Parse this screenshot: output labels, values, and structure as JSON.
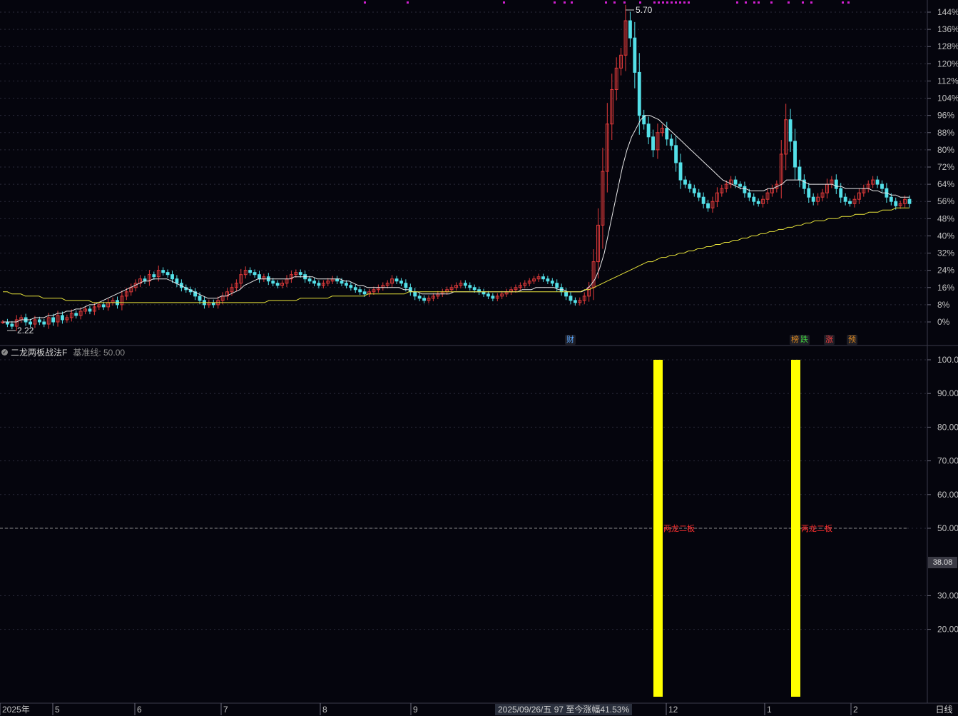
{
  "chart_data": [
    {
      "type": "candlestick",
      "title": "",
      "xlabel": "",
      "ylabel": "",
      "y_axis_ticks": [
        "144%",
        "136%",
        "128%",
        "120%",
        "112%",
        "104%",
        "96%",
        "88%",
        "80%",
        "72%",
        "64%",
        "56%",
        "48%",
        "40%",
        "32%",
        "24%",
        "16%",
        "8%",
        "0%"
      ],
      "ylim_percent": [
        -3,
        146
      ],
      "x_axis_ticks": [
        "2025年",
        "5",
        "6",
        "7",
        "8",
        "9",
        "12",
        "1",
        "2"
      ],
      "annotations": {
        "high_label": "5.70",
        "low_label": "2.22"
      },
      "series": [
        {
          "name": "",
          "kind": "candles",
          "close_percent": [
            0,
            -1,
            -2,
            1,
            2,
            0,
            -1,
            1,
            0,
            -1,
            2,
            0,
            3,
            1,
            2,
            4,
            3,
            5,
            6,
            5,
            7,
            8,
            7,
            9,
            10,
            8,
            12,
            14,
            16,
            18,
            20,
            19,
            22,
            21,
            24,
            23,
            22,
            20,
            18,
            16,
            15,
            14,
            12,
            10,
            8,
            9,
            8,
            10,
            12,
            14,
            16,
            18,
            22,
            24,
            23,
            22,
            20,
            21,
            19,
            18,
            17,
            18,
            20,
            22,
            23,
            22,
            20,
            19,
            18,
            17,
            18,
            19,
            20,
            19,
            18,
            17,
            16,
            15,
            14,
            13,
            14,
            15,
            16,
            17,
            18,
            20,
            19,
            18,
            16,
            14,
            12,
            11,
            10,
            11,
            12,
            13,
            14,
            15,
            16,
            17,
            18,
            17,
            16,
            15,
            14,
            13,
            12,
            11,
            12,
            13,
            14,
            15,
            16,
            17,
            18,
            19,
            20,
            21,
            20,
            19,
            18,
            16,
            14,
            12,
            10,
            9,
            10,
            12,
            16,
            28,
            45,
            70,
            92,
            108,
            118,
            124,
            140,
            132,
            116,
            96,
            92,
            86,
            80,
            88,
            90,
            85,
            82,
            74,
            66,
            64,
            62,
            60,
            58,
            55,
            53,
            56,
            60,
            62,
            64,
            66,
            64,
            63,
            60,
            58,
            56,
            55,
            57,
            60,
            62,
            64,
            78,
            94,
            84,
            72,
            66,
            62,
            58,
            56,
            58,
            60,
            64,
            66,
            62,
            58,
            56,
            55,
            57,
            60,
            62,
            64,
            66,
            64,
            62,
            58,
            56,
            54,
            55,
            57,
            55
          ]
        },
        {
          "name": "",
          "kind": "ma-white",
          "values_percent": [
            0,
            0,
            0,
            0,
            1,
            1,
            1,
            2,
            2,
            2,
            3,
            3,
            4,
            4,
            5,
            5,
            6,
            6,
            7,
            8,
            8,
            9,
            10,
            11,
            12,
            13,
            14,
            15,
            16,
            17,
            18,
            19,
            19,
            20,
            20,
            20,
            20,
            19,
            18,
            17,
            16,
            15,
            14,
            13,
            12,
            11,
            11,
            11,
            12,
            12,
            13,
            14,
            15,
            17,
            18,
            19,
            20,
            20,
            20,
            20,
            20,
            20,
            20,
            20,
            21,
            21,
            21,
            21,
            21,
            20,
            20,
            20,
            20,
            20,
            20,
            19,
            19,
            18,
            17,
            17,
            16,
            16,
            16,
            16,
            16,
            16,
            16,
            16,
            15,
            15,
            14,
            14,
            13,
            13,
            13,
            13,
            13,
            13,
            13,
            14,
            14,
            14,
            14,
            14,
            14,
            14,
            14,
            14,
            14,
            14,
            14,
            14,
            14,
            14,
            15,
            15,
            15,
            16,
            16,
            16,
            16,
            16,
            15,
            15,
            14,
            14,
            14,
            14,
            15,
            17,
            20,
            25,
            32,
            42,
            52,
            62,
            72,
            80,
            86,
            90,
            94,
            96,
            96,
            95,
            94,
            92,
            90,
            88,
            86,
            84,
            82,
            80,
            78,
            76,
            74,
            72,
            70,
            68,
            66,
            65,
            64,
            63,
            62,
            62,
            61,
            61,
            61,
            61,
            62,
            62,
            63,
            64,
            66,
            66,
            66,
            66,
            65,
            64,
            64,
            64,
            64,
            64,
            64,
            63,
            63,
            62,
            62,
            62,
            62,
            62,
            62,
            61,
            61,
            60,
            60,
            59,
            59,
            58,
            58,
            58
          ]
        },
        {
          "name": "",
          "kind": "ma-yellow",
          "values_percent": [
            14,
            14,
            13,
            13,
            13,
            12,
            12,
            12,
            12,
            11,
            11,
            11,
            11,
            11,
            10,
            10,
            10,
            10,
            10,
            10,
            9,
            9,
            9,
            9,
            9,
            9,
            9,
            9,
            9,
            9,
            9,
            9,
            9,
            9,
            9,
            9,
            9,
            9,
            9,
            9,
            9,
            9,
            9,
            9,
            9,
            9,
            9,
            9,
            9,
            9,
            9,
            9,
            9,
            9,
            9,
            9,
            9,
            9,
            9,
            10,
            10,
            10,
            10,
            10,
            10,
            10,
            11,
            11,
            11,
            11,
            11,
            11,
            11,
            12,
            12,
            12,
            12,
            12,
            12,
            12,
            12,
            13,
            13,
            13,
            13,
            13,
            13,
            13,
            13,
            13,
            14,
            14,
            14,
            14,
            14,
            14,
            14,
            14,
            14,
            14,
            14,
            14,
            14,
            14,
            14,
            14,
            14,
            14,
            14,
            14,
            14,
            14,
            14,
            14,
            14,
            14,
            14,
            14,
            14,
            14,
            14,
            14,
            14,
            14,
            14,
            14,
            14,
            14,
            14,
            15,
            15,
            16,
            17,
            18,
            19,
            20,
            21,
            22,
            23,
            24,
            25,
            26,
            27,
            28,
            28,
            29,
            30,
            30,
            31,
            31,
            32,
            32,
            33,
            33,
            34,
            34,
            35,
            35,
            36,
            36,
            37,
            37,
            38,
            38,
            39,
            39,
            40,
            40,
            41,
            41,
            42,
            42,
            43,
            43,
            44,
            44,
            45,
            45,
            46,
            46,
            47,
            47,
            47,
            48,
            48,
            48,
            49,
            49,
            49,
            50,
            50,
            50,
            51,
            51,
            51,
            52,
            52,
            52,
            53,
            53,
            53,
            53
          ]
        }
      ]
    },
    {
      "type": "bar",
      "title": "二龙两板战法F",
      "baseline_label": "基准线: 50.00",
      "y_axis_ticks": [
        "100.00",
        "90.00",
        "80.00",
        "70.00",
        "60.00",
        "50.00",
        "30.00",
        "20.00"
      ],
      "ylim": [
        0,
        100
      ],
      "current_value_label": "38.08",
      "series": [
        {
          "name": "",
          "bars": [
            {
              "value": 100,
              "label": "两龙二板"
            },
            {
              "value": 100,
              "label": "两龙二板"
            }
          ]
        }
      ]
    }
  ],
  "badges": [
    {
      "text": "财",
      "color": "#5aa8ff"
    },
    {
      "text": "榜",
      "color": "#e08a20"
    },
    {
      "text": "跌",
      "color": "#40d040"
    },
    {
      "text": "涨",
      "color": "#ff4040"
    },
    {
      "text": "预",
      "color": "#e08a20"
    }
  ],
  "status": "2025/09/26/五 97 至今涨幅41.53%",
  "period_button": "日线",
  "colors": {
    "up": "#e03a3a",
    "down": "#54e0e8",
    "ma_white": "#e8e8e8",
    "ma_yellow": "#e6e23a",
    "indicator_bar": "#ffff00",
    "axis_text": "#c0c0c0",
    "grid": "#2a2a3a",
    "marker": "#d020d0"
  }
}
